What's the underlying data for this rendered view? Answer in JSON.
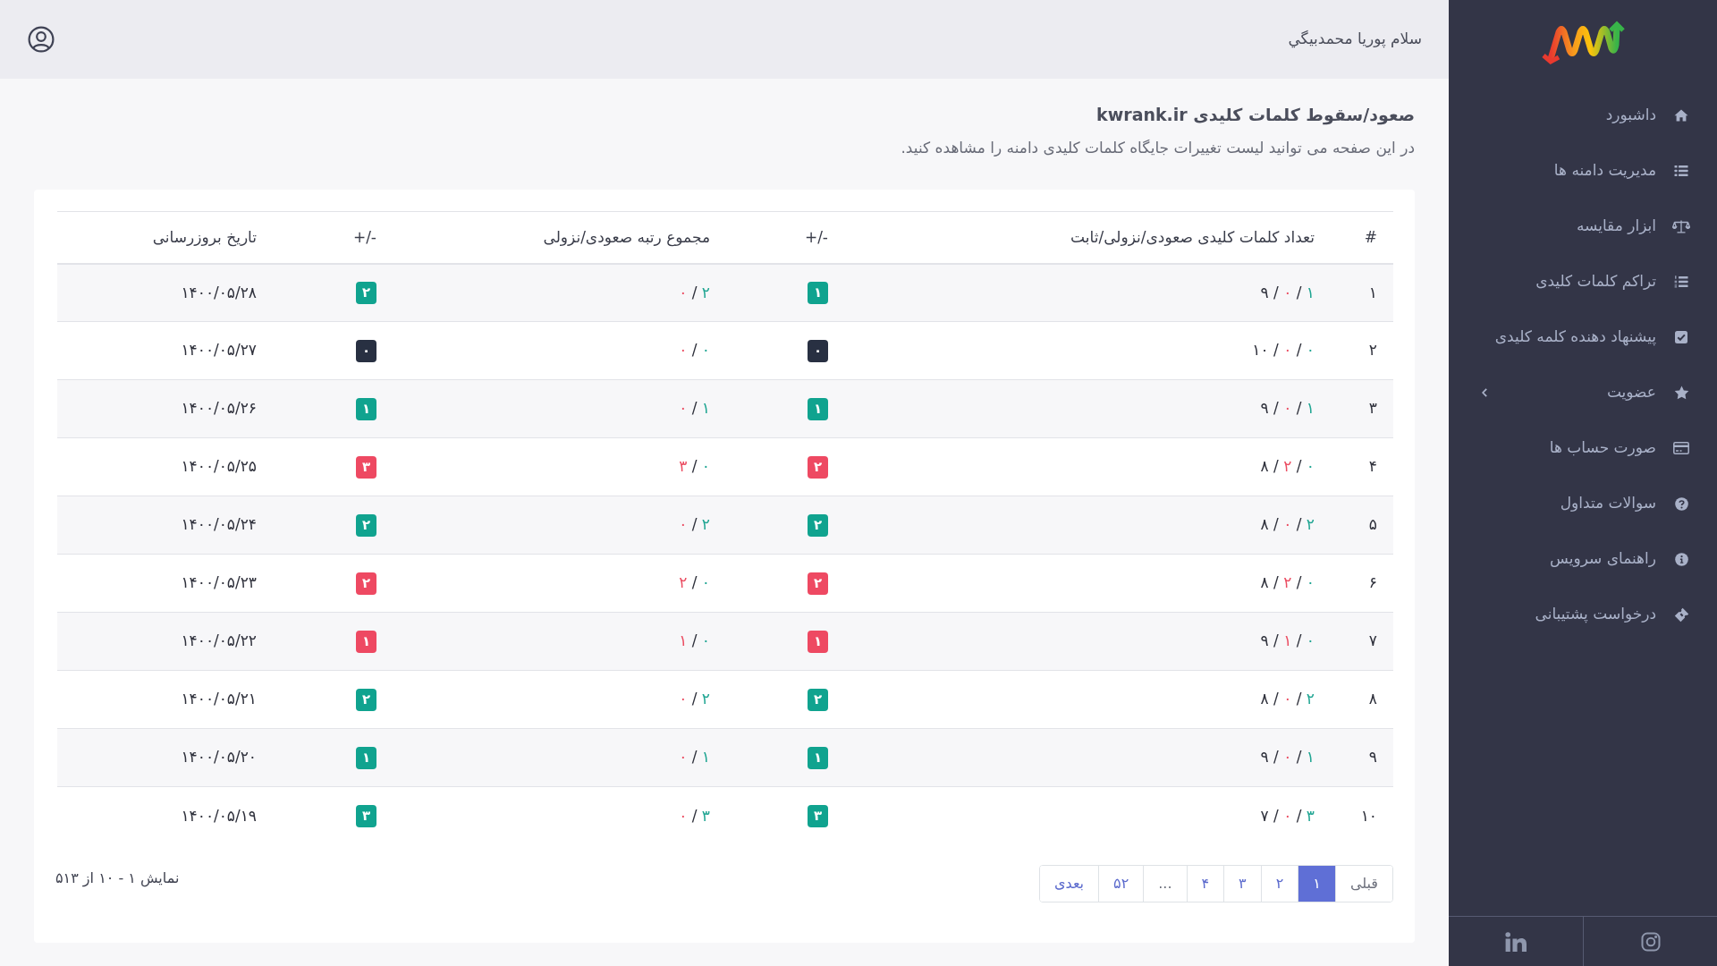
{
  "sidebar": {
    "items": [
      {
        "label": "داشبورد",
        "kind": "link"
      },
      {
        "label": "مدیریت دامنه ها",
        "kind": "link"
      },
      {
        "label": "ابزار مقایسه",
        "kind": "link"
      },
      {
        "label": "تراکم کلمات کلیدی",
        "kind": "link"
      },
      {
        "label": "پیشنهاد دهنده کلمه کلیدی",
        "kind": "link"
      },
      {
        "label": "عضویت",
        "kind": "submenu",
        "expanded": false
      },
      {
        "label": "صورت حساب ها",
        "kind": "link"
      },
      {
        "label": "سوالات متداول",
        "kind": "link"
      },
      {
        "label": "راهنمای سرویس",
        "kind": "link"
      },
      {
        "label": "درخواست پشتیبانی",
        "kind": "link"
      }
    ]
  },
  "header": {
    "greeting": "سلام پوریا محمدبیگي"
  },
  "page": {
    "title": "صعود/سقوط کلمات کلیدی kwrank.ir",
    "description": "در این صفحه می توانید لیست تغییرات جایگاه کلمات کلیدی دامنه را مشاهده کنید."
  },
  "table": {
    "columns": [
      {
        "label": "#"
      },
      {
        "label": "تعداد کلمات کلیدی صعودی/نزولی/ثابت"
      },
      {
        "label": "+/-"
      },
      {
        "label": "مجموع رتبه صعودی/نزولی"
      },
      {
        "label": "+/-"
      },
      {
        "label": "تاریخ بروزرسانی"
      }
    ],
    "rows": [
      {
        "number": "۱",
        "keywords": "۱ / ۰ / ۹",
        "keywords_change": {
          "value": "۱",
          "color": "#10a38f"
        },
        "rank": "۲ / ۰",
        "rank_change": {
          "value": "۲",
          "color": "#10a38f"
        },
        "updated": "۱۴۰۰/۰۵/۲۸"
      },
      {
        "number": "۲",
        "keywords": "۰ / ۰ / ۱۰",
        "keywords_change": {
          "value": "۰",
          "color": "#283042"
        },
        "rank": "۰ / ۰",
        "rank_change": {
          "value": "۰",
          "color": "#283042"
        },
        "updated": "۱۴۰۰/۰۵/۲۷"
      },
      {
        "number": "۳",
        "keywords": "۱ / ۰ / ۹",
        "keywords_change": {
          "value": "۱",
          "color": "#10a38f"
        },
        "rank": "۱ / ۰",
        "rank_change": {
          "value": "۱",
          "color": "#10a38f"
        },
        "updated": "۱۴۰۰/۰۵/۲۶"
      },
      {
        "number": "۴",
        "keywords": "۰ / ۲ / ۸",
        "keywords_change": {
          "value": "۲",
          "color": "#ee4962"
        },
        "rank": "۰ / ۳",
        "rank_change": {
          "value": "۳",
          "color": "#ee4962"
        },
        "updated": "۱۴۰۰/۰۵/۲۵"
      },
      {
        "number": "۵",
        "keywords": "۲ / ۰ / ۸",
        "keywords_change": {
          "value": "۲",
          "color": "#10a38f"
        },
        "rank": "۲ / ۰",
        "rank_change": {
          "value": "۲",
          "color": "#10a38f"
        },
        "updated": "۱۴۰۰/۰۵/۲۴"
      },
      {
        "number": "۶",
        "keywords": "۰ / ۲ / ۸",
        "keywords_change": {
          "value": "۲",
          "color": "#ee4962"
        },
        "rank": "۰ / ۲",
        "rank_change": {
          "value": "۲",
          "color": "#ee4962"
        },
        "updated": "۱۴۰۰/۰۵/۲۳"
      },
      {
        "number": "۷",
        "keywords": "۰ / ۱ / ۹",
        "keywords_change": {
          "value": "۱",
          "color": "#ee4962"
        },
        "rank": "۰ / ۱",
        "rank_change": {
          "value": "۱",
          "color": "#ee4962"
        },
        "updated": "۱۴۰۰/۰۵/۲۲"
      },
      {
        "number": "۸",
        "keywords": "۲ / ۰ / ۸",
        "keywords_change": {
          "value": "۲",
          "color": "#10a38f"
        },
        "rank": "۲ / ۰",
        "rank_change": {
          "value": "۲",
          "color": "#10a38f"
        },
        "updated": "۱۴۰۰/۰۵/۲۱"
      },
      {
        "number": "۹",
        "keywords": "۱ / ۰ / ۹",
        "keywords_change": {
          "value": "۱",
          "color": "#10a38f"
        },
        "rank": "۱ / ۰",
        "rank_change": {
          "value": "۱",
          "color": "#10a38f"
        },
        "updated": "۱۴۰۰/۰۵/۲۰"
      },
      {
        "number": "۱۰",
        "keywords": "۳ / ۰ / ۷",
        "keywords_change": {
          "value": "۳",
          "color": "#10a38f"
        },
        "rank": "۳ / ۰",
        "rank_change": {
          "value": "۳",
          "color": "#10a38f"
        },
        "updated": "۱۴۰۰/۰۵/۱۹"
      }
    ]
  },
  "pagination": {
    "pages": [
      {
        "label": "قبلی",
        "selected": false,
        "disabled": true
      },
      {
        "label": "۱",
        "selected": true,
        "disabled": false
      },
      {
        "label": "۲",
        "selected": false,
        "disabled": false
      },
      {
        "label": "۳",
        "selected": false,
        "disabled": false
      },
      {
        "label": "۴",
        "selected": false,
        "disabled": false
      },
      {
        "label": "...",
        "selected": false,
        "disabled": true
      },
      {
        "label": "۵۲",
        "selected": false,
        "disabled": false
      },
      {
        "label": "بعدی",
        "selected": false,
        "disabled": false
      }
    ],
    "summary": "نمایش ۱ - ۱۰ از ۵۱۳"
  }
}
